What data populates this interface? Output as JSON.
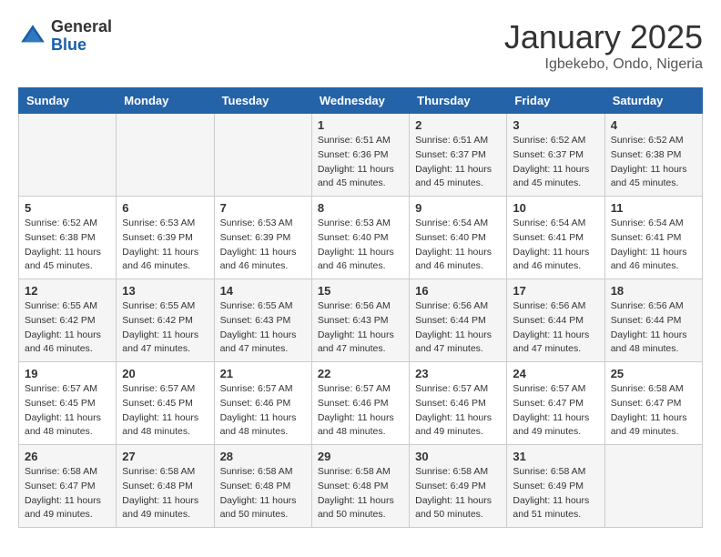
{
  "header": {
    "logo_general": "General",
    "logo_blue": "Blue",
    "month_title": "January 2025",
    "location": "Igbekebo, Ondo, Nigeria"
  },
  "days_of_week": [
    "Sunday",
    "Monday",
    "Tuesday",
    "Wednesday",
    "Thursday",
    "Friday",
    "Saturday"
  ],
  "weeks": [
    [
      {
        "day": "",
        "sunrise": "",
        "sunset": "",
        "daylight": ""
      },
      {
        "day": "",
        "sunrise": "",
        "sunset": "",
        "daylight": ""
      },
      {
        "day": "",
        "sunrise": "",
        "sunset": "",
        "daylight": ""
      },
      {
        "day": "1",
        "sunrise": "Sunrise: 6:51 AM",
        "sunset": "Sunset: 6:36 PM",
        "daylight": "Daylight: 11 hours and 45 minutes."
      },
      {
        "day": "2",
        "sunrise": "Sunrise: 6:51 AM",
        "sunset": "Sunset: 6:37 PM",
        "daylight": "Daylight: 11 hours and 45 minutes."
      },
      {
        "day": "3",
        "sunrise": "Sunrise: 6:52 AM",
        "sunset": "Sunset: 6:37 PM",
        "daylight": "Daylight: 11 hours and 45 minutes."
      },
      {
        "day": "4",
        "sunrise": "Sunrise: 6:52 AM",
        "sunset": "Sunset: 6:38 PM",
        "daylight": "Daylight: 11 hours and 45 minutes."
      }
    ],
    [
      {
        "day": "5",
        "sunrise": "Sunrise: 6:52 AM",
        "sunset": "Sunset: 6:38 PM",
        "daylight": "Daylight: 11 hours and 45 minutes."
      },
      {
        "day": "6",
        "sunrise": "Sunrise: 6:53 AM",
        "sunset": "Sunset: 6:39 PM",
        "daylight": "Daylight: 11 hours and 46 minutes."
      },
      {
        "day": "7",
        "sunrise": "Sunrise: 6:53 AM",
        "sunset": "Sunset: 6:39 PM",
        "daylight": "Daylight: 11 hours and 46 minutes."
      },
      {
        "day": "8",
        "sunrise": "Sunrise: 6:53 AM",
        "sunset": "Sunset: 6:40 PM",
        "daylight": "Daylight: 11 hours and 46 minutes."
      },
      {
        "day": "9",
        "sunrise": "Sunrise: 6:54 AM",
        "sunset": "Sunset: 6:40 PM",
        "daylight": "Daylight: 11 hours and 46 minutes."
      },
      {
        "day": "10",
        "sunrise": "Sunrise: 6:54 AM",
        "sunset": "Sunset: 6:41 PM",
        "daylight": "Daylight: 11 hours and 46 minutes."
      },
      {
        "day": "11",
        "sunrise": "Sunrise: 6:54 AM",
        "sunset": "Sunset: 6:41 PM",
        "daylight": "Daylight: 11 hours and 46 minutes."
      }
    ],
    [
      {
        "day": "12",
        "sunrise": "Sunrise: 6:55 AM",
        "sunset": "Sunset: 6:42 PM",
        "daylight": "Daylight: 11 hours and 46 minutes."
      },
      {
        "day": "13",
        "sunrise": "Sunrise: 6:55 AM",
        "sunset": "Sunset: 6:42 PM",
        "daylight": "Daylight: 11 hours and 47 minutes."
      },
      {
        "day": "14",
        "sunrise": "Sunrise: 6:55 AM",
        "sunset": "Sunset: 6:43 PM",
        "daylight": "Daylight: 11 hours and 47 minutes."
      },
      {
        "day": "15",
        "sunrise": "Sunrise: 6:56 AM",
        "sunset": "Sunset: 6:43 PM",
        "daylight": "Daylight: 11 hours and 47 minutes."
      },
      {
        "day": "16",
        "sunrise": "Sunrise: 6:56 AM",
        "sunset": "Sunset: 6:44 PM",
        "daylight": "Daylight: 11 hours and 47 minutes."
      },
      {
        "day": "17",
        "sunrise": "Sunrise: 6:56 AM",
        "sunset": "Sunset: 6:44 PM",
        "daylight": "Daylight: 11 hours and 47 minutes."
      },
      {
        "day": "18",
        "sunrise": "Sunrise: 6:56 AM",
        "sunset": "Sunset: 6:44 PM",
        "daylight": "Daylight: 11 hours and 48 minutes."
      }
    ],
    [
      {
        "day": "19",
        "sunrise": "Sunrise: 6:57 AM",
        "sunset": "Sunset: 6:45 PM",
        "daylight": "Daylight: 11 hours and 48 minutes."
      },
      {
        "day": "20",
        "sunrise": "Sunrise: 6:57 AM",
        "sunset": "Sunset: 6:45 PM",
        "daylight": "Daylight: 11 hours and 48 minutes."
      },
      {
        "day": "21",
        "sunrise": "Sunrise: 6:57 AM",
        "sunset": "Sunset: 6:46 PM",
        "daylight": "Daylight: 11 hours and 48 minutes."
      },
      {
        "day": "22",
        "sunrise": "Sunrise: 6:57 AM",
        "sunset": "Sunset: 6:46 PM",
        "daylight": "Daylight: 11 hours and 48 minutes."
      },
      {
        "day": "23",
        "sunrise": "Sunrise: 6:57 AM",
        "sunset": "Sunset: 6:46 PM",
        "daylight": "Daylight: 11 hours and 49 minutes."
      },
      {
        "day": "24",
        "sunrise": "Sunrise: 6:57 AM",
        "sunset": "Sunset: 6:47 PM",
        "daylight": "Daylight: 11 hours and 49 minutes."
      },
      {
        "day": "25",
        "sunrise": "Sunrise: 6:58 AM",
        "sunset": "Sunset: 6:47 PM",
        "daylight": "Daylight: 11 hours and 49 minutes."
      }
    ],
    [
      {
        "day": "26",
        "sunrise": "Sunrise: 6:58 AM",
        "sunset": "Sunset: 6:47 PM",
        "daylight": "Daylight: 11 hours and 49 minutes."
      },
      {
        "day": "27",
        "sunrise": "Sunrise: 6:58 AM",
        "sunset": "Sunset: 6:48 PM",
        "daylight": "Daylight: 11 hours and 49 minutes."
      },
      {
        "day": "28",
        "sunrise": "Sunrise: 6:58 AM",
        "sunset": "Sunset: 6:48 PM",
        "daylight": "Daylight: 11 hours and 50 minutes."
      },
      {
        "day": "29",
        "sunrise": "Sunrise: 6:58 AM",
        "sunset": "Sunset: 6:48 PM",
        "daylight": "Daylight: 11 hours and 50 minutes."
      },
      {
        "day": "30",
        "sunrise": "Sunrise: 6:58 AM",
        "sunset": "Sunset: 6:49 PM",
        "daylight": "Daylight: 11 hours and 50 minutes."
      },
      {
        "day": "31",
        "sunrise": "Sunrise: 6:58 AM",
        "sunset": "Sunset: 6:49 PM",
        "daylight": "Daylight: 11 hours and 51 minutes."
      },
      {
        "day": "",
        "sunrise": "",
        "sunset": "",
        "daylight": ""
      }
    ]
  ]
}
